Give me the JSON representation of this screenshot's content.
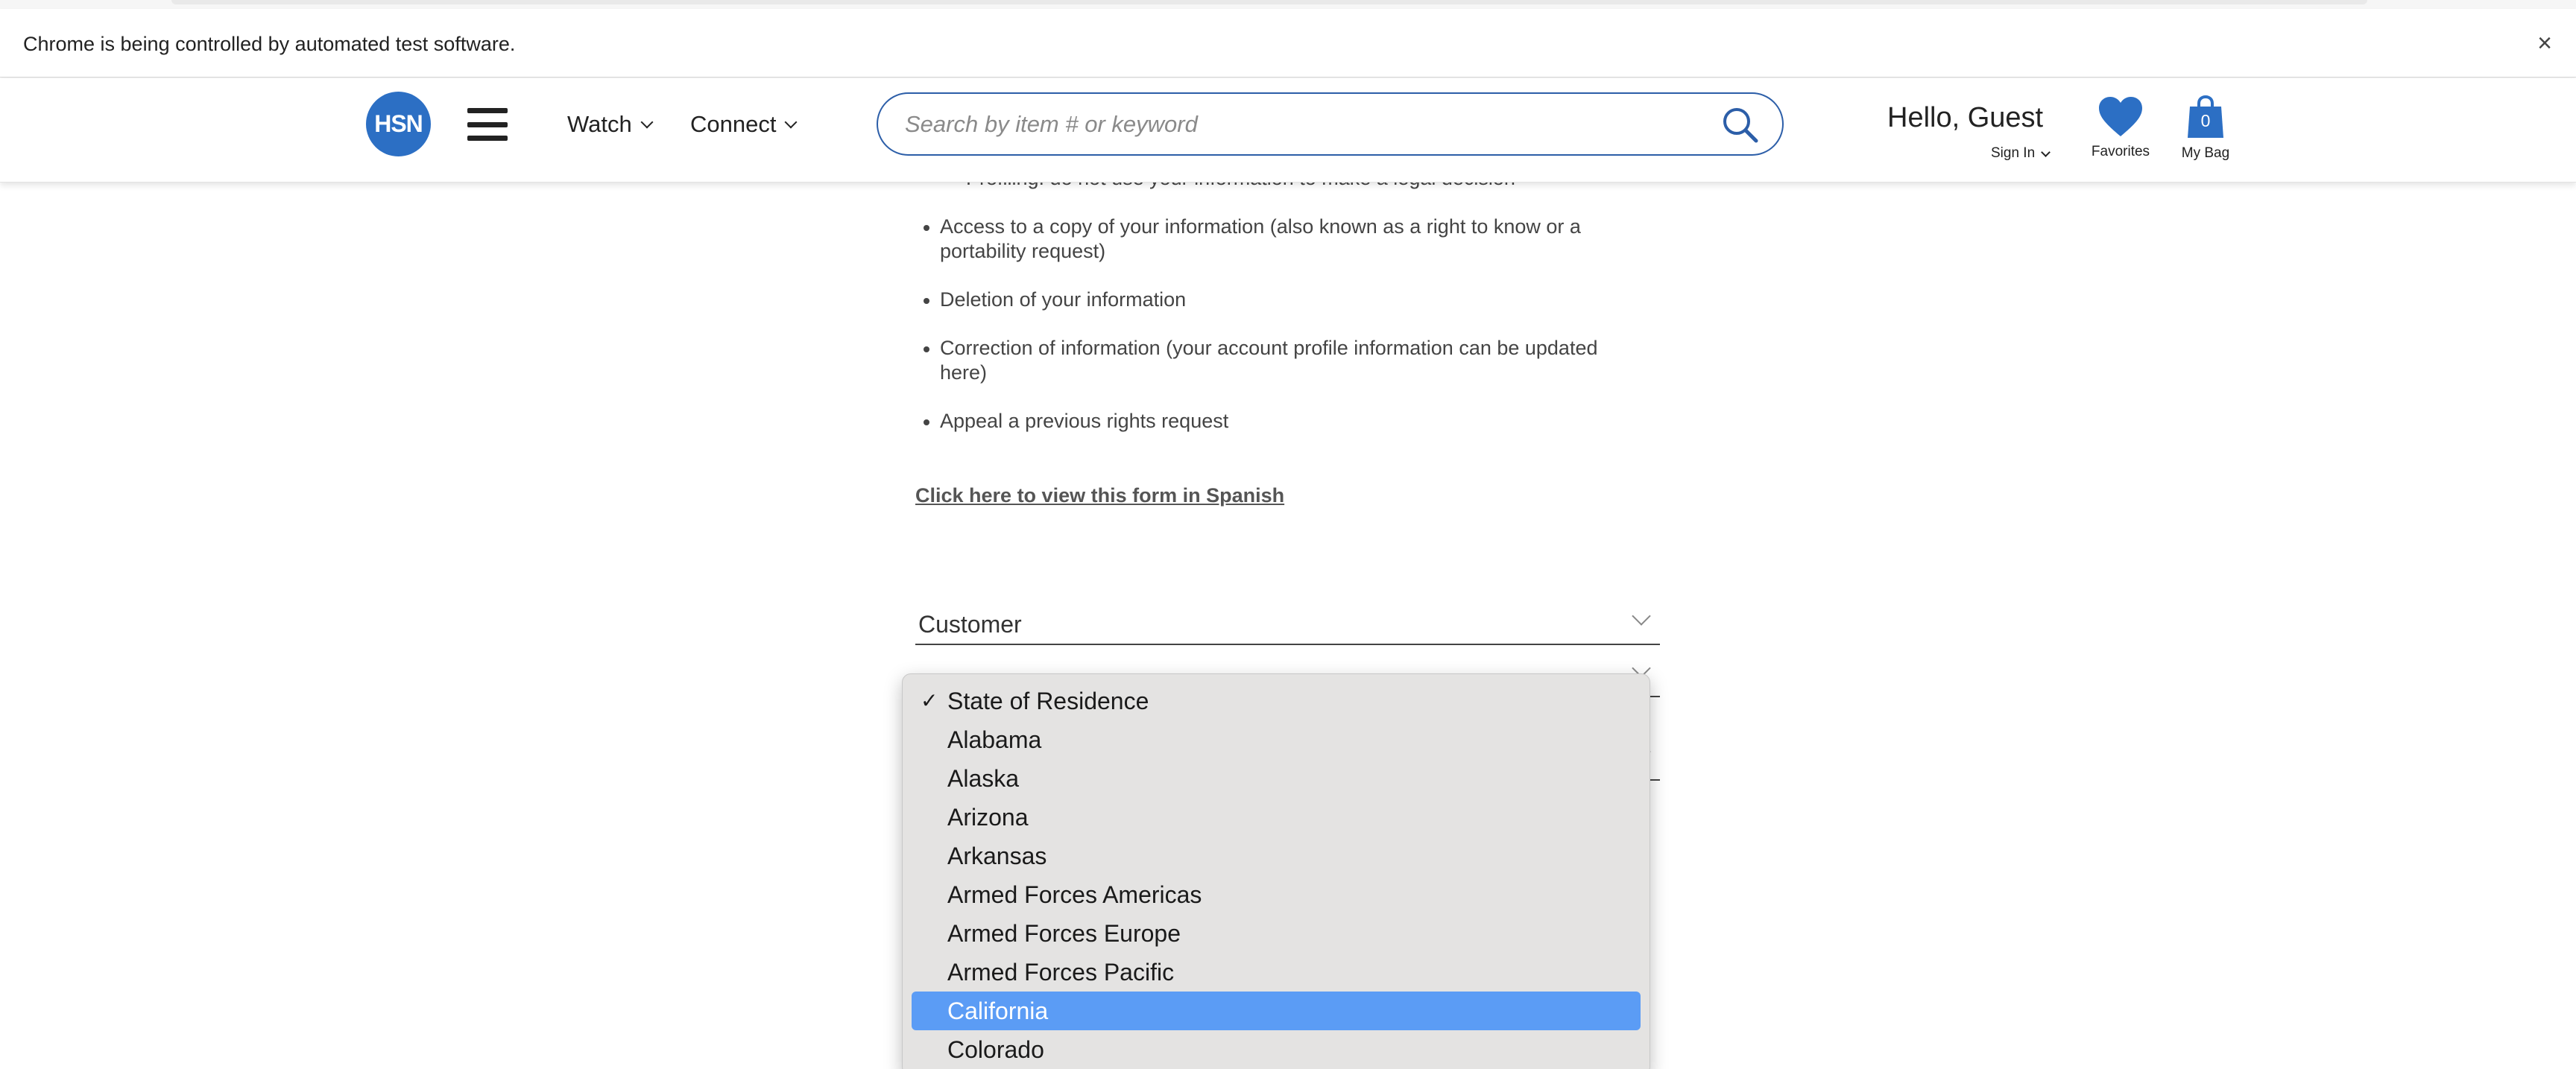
{
  "infobar": {
    "message": "Chrome is being controlled by automated test software.",
    "close_glyph": "×"
  },
  "header": {
    "logo_text": "HSN",
    "brand_color": "#2c6fc4",
    "nav": {
      "watch_label": "Watch",
      "connect_label": "Connect"
    },
    "search": {
      "placeholder": "Search by item # or keyword",
      "value": ""
    },
    "greeting": "Hello, Guest",
    "sign_in_label": "Sign In",
    "favorites_label": "Favorites",
    "bag_label": "My Bag",
    "bag_count": "0"
  },
  "content": {
    "partial_line": "Profiling: do not use your information to make a legal decision",
    "rights": [
      "Access to a copy of your information (also known as a right to know or a portability request)",
      "Deletion of your information",
      "Correction of information (your account profile information can be updated here)",
      "Appeal a previous rights request"
    ],
    "spanish_link": "Click here to view this form in Spanish",
    "customer_select_value": "Customer"
  },
  "dropdown": {
    "checked_glyph": "✓",
    "options": [
      "State of Residence",
      "Alabama",
      "Alaska",
      "Arizona",
      "Arkansas",
      "Armed Forces Americas",
      "Armed Forces Europe",
      "Armed Forces Pacific",
      "California",
      "Colorado"
    ],
    "checked_option": "State of Residence",
    "highlighted_option": "California",
    "highlight_color": "#5b9cf5"
  }
}
